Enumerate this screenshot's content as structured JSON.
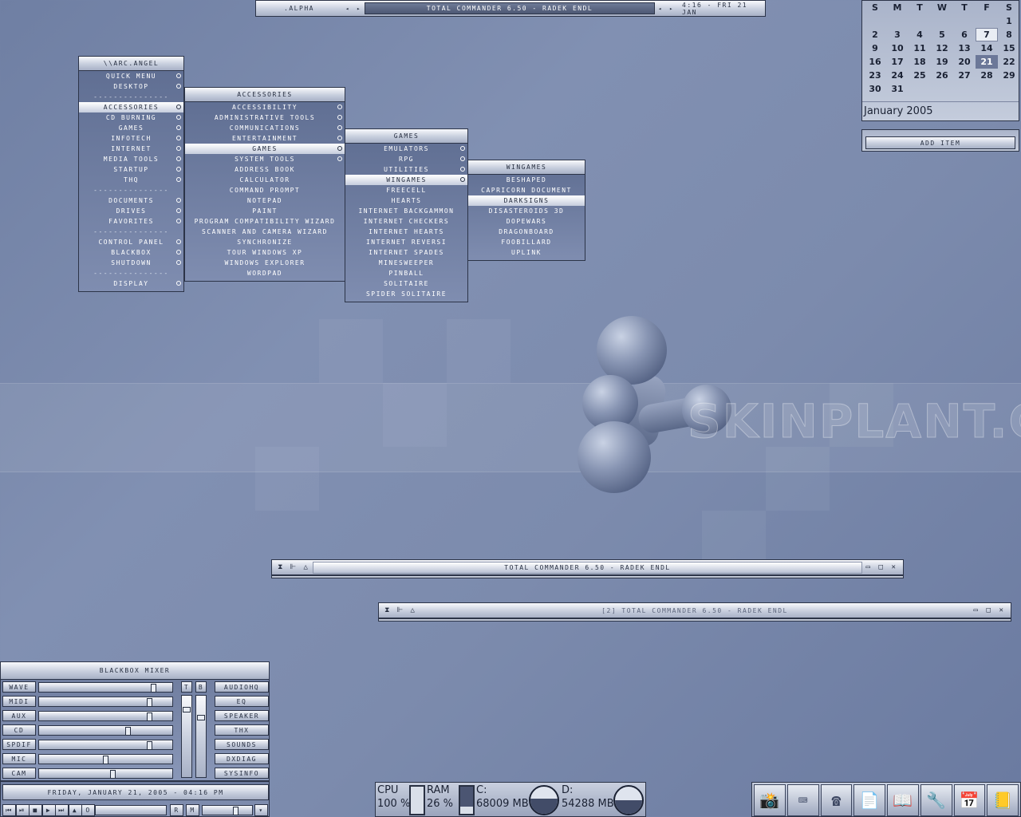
{
  "toolbar": {
    "left_label": ".ALPHA",
    "title": "TOTAL COMMANDER 6.50 - RADEK ENDL",
    "clock": "4:16 - FRI 21 JAN",
    "arrow_left": "◂",
    "arrow_right": "▸"
  },
  "start_menu": {
    "title": "\\\\ARC.ANGEL",
    "items": [
      "QUICK MENU",
      "DESKTOP",
      "---------------",
      "ACCESSORIES",
      "CD BURNING",
      "GAMES",
      "INFOTECH",
      "INTERNET",
      "MEDIA TOOLS",
      "STARTUP",
      "THQ",
      "---------------",
      "DOCUMENTS",
      "DRIVES",
      "FAVORITES",
      "---------------",
      "CONTROL PANEL",
      "BLACKBOX",
      "SHUTDOWN",
      "---------------",
      "DISPLAY"
    ]
  },
  "accessories_menu": {
    "title": "ACCESSORIES",
    "items": [
      "ACCESSIBILITY",
      "ADMINISTRATIVE TOOLS",
      "COMMUNICATIONS",
      "ENTERTAINMENT",
      "GAMES",
      "SYSTEM TOOLS",
      "ADDRESS BOOK",
      "CALCULATOR",
      "COMMAND PROMPT",
      "NOTEPAD",
      "PAINT",
      "PROGRAM COMPATIBILITY WIZARD",
      "SCANNER AND CAMERA WIZARD",
      "SYNCHRONIZE",
      "TOUR WINDOWS XP",
      "WINDOWS EXPLORER",
      "WORDPAD"
    ]
  },
  "games_menu": {
    "title": "GAMES",
    "items": [
      "EMULATORS",
      "RPG",
      "UTILITIES",
      "WINGAMES",
      "FREECELL",
      "HEARTS",
      "INTERNET BACKGAMMON",
      "INTERNET CHECKERS",
      "INTERNET HEARTS",
      "INTERNET REVERSI",
      "INTERNET SPADES",
      "MINESWEEPER",
      "PINBALL",
      "SOLITAIRE",
      "SPIDER SOLITAIRE"
    ]
  },
  "wingames_menu": {
    "title": "WINGAMES",
    "items": [
      "BESHAPED",
      "CAPRICORN DOCUMENT",
      "DARKSIGNS",
      "DISASTEROIDS 3D",
      "DOPEWARS",
      "DRAGONBOARD",
      "FOOBILLARD",
      "UPLINK"
    ]
  },
  "calendar": {
    "weekdays": [
      "S",
      "M",
      "T",
      "W",
      "T",
      "F",
      "S"
    ],
    "days": [
      "",
      "",
      "",
      "",
      "",
      "",
      "1",
      "2",
      "3",
      "4",
      "5",
      "6",
      "7",
      "8",
      "9",
      "10",
      "11",
      "12",
      "13",
      "14",
      "15",
      "16",
      "17",
      "18",
      "19",
      "20",
      "21",
      "22",
      "23",
      "24",
      "25",
      "26",
      "27",
      "28",
      "29",
      "30",
      "31"
    ],
    "today": "21",
    "marked": "7",
    "month": "January 2005",
    "add_item": "ADD ITEM"
  },
  "watermark": "SKINPLANT.COM",
  "windows": [
    {
      "title": "TOTAL COMMANDER 6.50 - RADEK ENDL",
      "state": "active"
    },
    {
      "title": "[2] TOTAL COMMANDER 6.50 - RADEK ENDL",
      "state": "inactive"
    }
  ],
  "mixer": {
    "title": "BLACKBOX MIXER",
    "channels": [
      {
        "label": "WAVE",
        "level": 0.88,
        "side": "AUDIOHQ"
      },
      {
        "label": "MIDI",
        "level": 0.85,
        "side": "EQ"
      },
      {
        "label": "AUX",
        "level": 0.85,
        "side": "SPEAKER"
      },
      {
        "label": "CD",
        "level": 0.68,
        "side": "THX"
      },
      {
        "label": "SPDIF",
        "level": 0.85,
        "side": "SOUNDS"
      },
      {
        "label": "MIC",
        "level": 0.5,
        "side": "DXDIAG"
      },
      {
        "label": "CAM",
        "level": 0.56,
        "side": "SYSINFO"
      }
    ],
    "treble_label": "T",
    "bass_label": "B",
    "treble_level": 0.85,
    "bass_level": 0.75
  },
  "player": {
    "date": "FRIDAY, JANUARY 21, 2005 - 04:16 PM",
    "buttons": [
      "⏮",
      "⏯",
      "■",
      "▶",
      "⏭",
      "▲",
      "o"
    ],
    "repeat": "R",
    "mute": "M",
    "menu": "▾",
    "volume": 0.7
  },
  "sysmon": {
    "cpu_label": "CPU",
    "cpu_value": "100 %",
    "cpu_level": 1.0,
    "ram_label": "RAM",
    "ram_value": "26 %",
    "ram_level": 0.26,
    "c_label": "C:",
    "c_value": "68009 MB",
    "c_level": 0.55,
    "d_label": "D:",
    "d_value": "54288 MB",
    "d_level": 0.5
  },
  "tray_icons": [
    "📸",
    "⌨",
    "☎",
    "📄",
    "📖",
    "🔧",
    "📅",
    "📒"
  ]
}
